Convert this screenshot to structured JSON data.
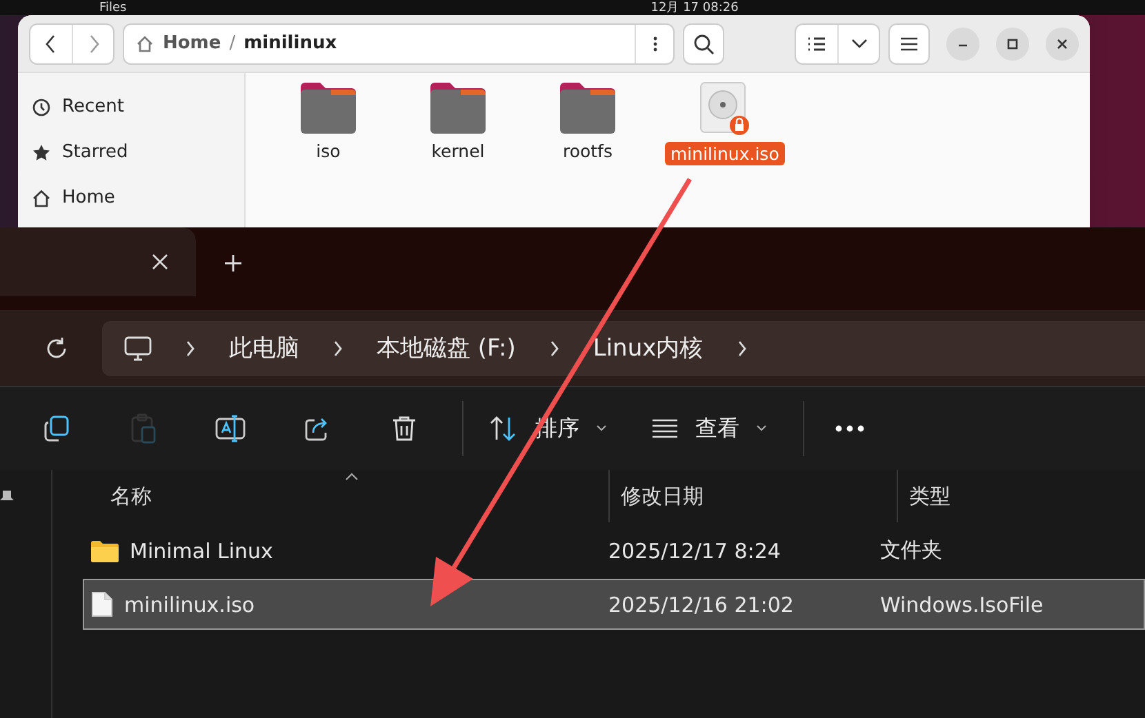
{
  "top_bar": {
    "app_name": "Files",
    "clock": "12月 17 08:26"
  },
  "files_window": {
    "path_separator": "/",
    "path": [
      {
        "label": "Home",
        "kind": "home"
      },
      {
        "label": "minilinux",
        "kind": "current"
      }
    ],
    "sidebar": [
      {
        "label": "Recent",
        "kind": "recent",
        "selected": false
      },
      {
        "label": "Starred",
        "kind": "star",
        "selected": false
      },
      {
        "label": "Home",
        "kind": "home",
        "selected": false
      }
    ],
    "items": [
      {
        "name": "iso",
        "kind": "folder",
        "selected": false
      },
      {
        "name": "kernel",
        "kind": "folder",
        "selected": false
      },
      {
        "name": "rootfs",
        "kind": "folder",
        "selected": false
      },
      {
        "name": "minilinux.iso",
        "kind": "disc",
        "selected": true
      }
    ]
  },
  "explorer": {
    "breadcrumb": [
      "此电脑",
      "本地磁盘 (F:)",
      "Linux内核"
    ],
    "toolbar": [
      {
        "kind": "copy",
        "disabled": false
      },
      {
        "kind": "paste",
        "disabled": true
      },
      {
        "kind": "rename",
        "disabled": false
      },
      {
        "kind": "share",
        "disabled": false
      },
      {
        "kind": "delete",
        "disabled": false
      }
    ],
    "sort_label": "排序",
    "view_label": "查看",
    "columns": [
      "名称",
      "修改日期",
      "类型"
    ],
    "rows": [
      {
        "kind": "folder",
        "name": "Minimal Linux",
        "date": "2025/12/17 8:24",
        "type": "文件夹",
        "selected": false
      },
      {
        "kind": "file",
        "name": "minilinux.iso",
        "date": "2025/12/16 21:02",
        "type": "Windows.IsoFile",
        "selected": true
      }
    ]
  }
}
